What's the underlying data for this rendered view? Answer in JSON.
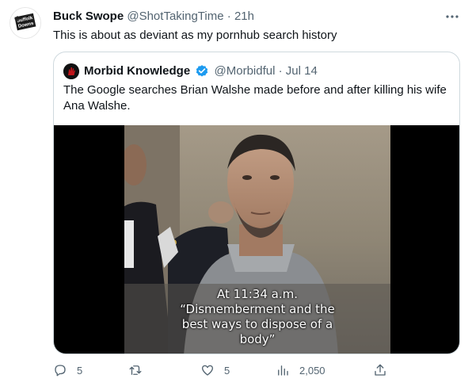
{
  "tweet": {
    "author_name": "Buck Swope",
    "handle": "@ShotTakingTime",
    "separator": "·",
    "time": "21h",
    "text": "This is about as deviant as my pornhub search history",
    "avatar_lines": [
      "Suffolk",
      "Downs"
    ],
    "more_icon": "more-horizontal-icon"
  },
  "quote": {
    "author_name": "Morbid Knowledge",
    "verified_icon": "verified-badge-icon",
    "handle": "@Morbidful",
    "separator": "·",
    "date": "Jul 14",
    "text": "The Google searches Brian Walshe made before and after killing his wife Ana Walshe.",
    "media": {
      "caption_lines": [
        "At 11:34 a.m.",
        "“Dismemberment and the",
        "best ways to dispose of a",
        "body”"
      ]
    }
  },
  "actions": {
    "reply": {
      "icon": "reply-icon",
      "count": "5"
    },
    "retweet": {
      "icon": "retweet-icon",
      "count": ""
    },
    "like": {
      "icon": "heart-icon",
      "count": "5"
    },
    "views": {
      "icon": "views-chart-icon",
      "count": "2,050"
    },
    "share": {
      "icon": "share-icon"
    }
  },
  "colors": {
    "text": "#0f1419",
    "muted": "#536471",
    "border": "#cfd9de",
    "verified": "#1d9bf0"
  }
}
